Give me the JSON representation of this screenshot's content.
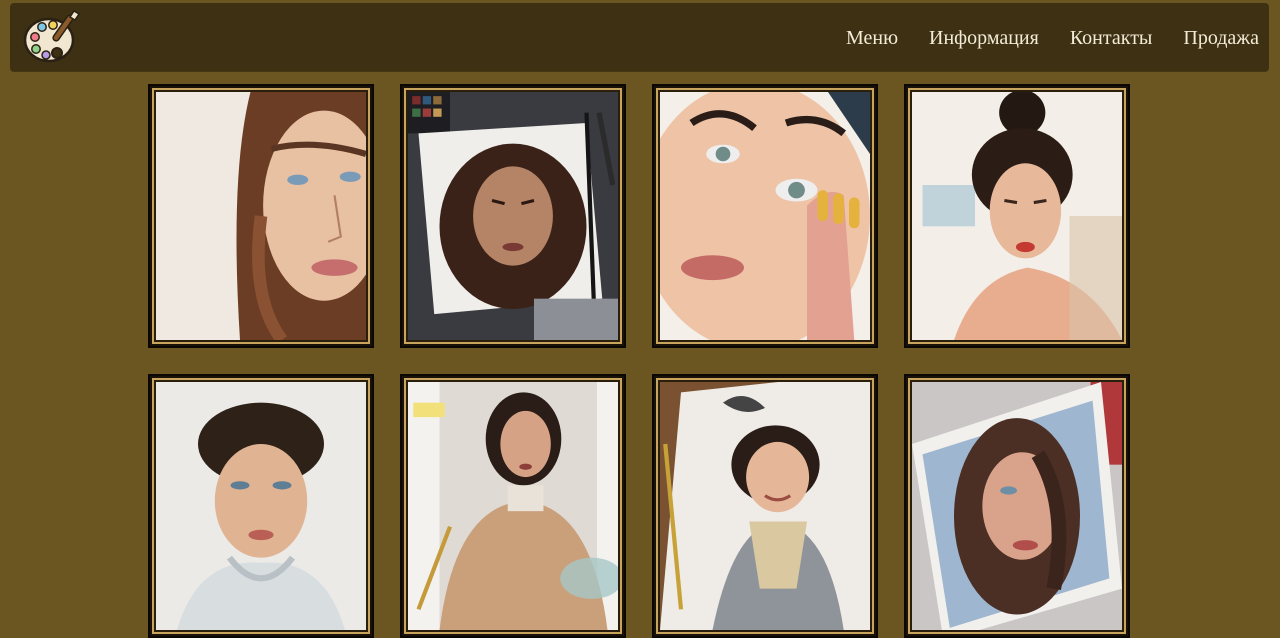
{
  "header": {
    "logo_icon": "paint-palette-icon",
    "menu": [
      {
        "label": "Меню"
      },
      {
        "label": "Информация"
      },
      {
        "label": "Контакты"
      },
      {
        "label": "Продажа"
      }
    ]
  },
  "colors": {
    "page_background": "#6b5520",
    "navbar_background": "#3d3013",
    "menu_text": "#f3ecd8",
    "frame_gold": "#c9a45c"
  },
  "gallery": {
    "items": [
      {
        "subject": "watercolor-portrait-girl-blue-eyes"
      },
      {
        "subject": "watercolor-portrait-curly-hair"
      },
      {
        "subject": "watercolor-portrait-closeup-hand"
      },
      {
        "subject": "watercolor-portrait-hair-bun"
      },
      {
        "subject": "watercolor-portrait-hoodie"
      },
      {
        "subject": "watercolor-portrait-trench-coat"
      },
      {
        "subject": "watercolor-portrait-child"
      },
      {
        "subject": "watercolor-portrait-long-hair"
      }
    ]
  }
}
